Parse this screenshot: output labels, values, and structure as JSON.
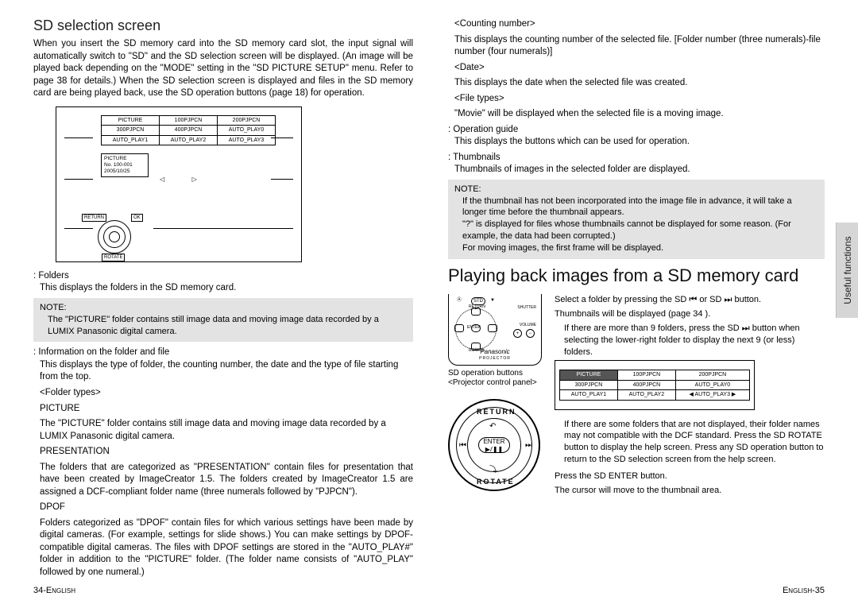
{
  "left": {
    "h2": "SD selection screen",
    "intro": "When you insert the SD memory card into the SD memory card slot, the input signal will automatically switch to \"SD\" and the SD selection screen will be displayed. (An image will be played back depending on the \"MODE\" setting in the \"SD PICTURE SETUP\" menu. Refer to page 38 for details.) When the SD selection screen is displayed and files in the SD memory card are being played back, use the SD operation buttons (page 18) for operation.",
    "diagram": {
      "tbl": [
        [
          "PICTURE",
          "100PJPCN",
          "200PJPCN"
        ],
        [
          "300PJPCN",
          "400PJPCN",
          "AUTO_PLAY0"
        ],
        [
          "AUTO_PLAY1",
          "AUTO_PLAY2",
          "AUTO_PLAY3"
        ]
      ],
      "info": [
        "PICTURE",
        "No. 100-001",
        "2005/10/25"
      ],
      "pad": {
        "return": "RETURN",
        "ok": "OK",
        "rotate": "ROTATE"
      }
    },
    "folders_lbl": ": Folders",
    "folders_txt": "This displays the folders in the SD memory card.",
    "note1_hd": "NOTE:",
    "note1_txt": "The \"PICTURE\" folder contains still image data and moving image data recorded by a LUMIX Panasonic digital camera.",
    "info_lbl": ": Information on the folder and file",
    "info_txt": "This displays the type of folder, the counting number, the date and the type of file starting from the top.",
    "ft_lbl": "<Folder types>",
    "picture_hd": "PICTURE",
    "picture_txt": "The \"PICTURE\" folder contains still image data and moving image data recorded by a LUMIX Panasonic digital camera.",
    "pres_hd": "PRESENTATION",
    "pres_txt": "The folders that are categorized as \"PRESENTATION\" contain files for presentation that have been created by ImageCreator 1.5. The folders created by ImageCreator 1.5 are assigned a DCF-compliant folder name (three numerals followed by \"PJPCN\").",
    "dpof_hd": "DPOF",
    "dpof_txt": "Folders categorized as \"DPOF\" contain files for which various settings have been made by digital cameras. (For example, settings for slide shows.) You can make settings by DPOF-compatible digital cameras. The files with DPOF settings are stored in the \"AUTO_PLAY#\" folder in addition to the \"PICTURE\" folder. (The folder name consists of \"AUTO_PLAY\" followed by one numeral.)",
    "footer": "34-English"
  },
  "right": {
    "cnt_lbl": "<Counting number>",
    "cnt_txt": "This displays the counting number of the selected file. [Folder number (three numerals)-file number (four numerals)]",
    "date_lbl": "<Date>",
    "date_txt": "This displays the date when the selected file was created.",
    "ftypes_lbl": "<File types>",
    "ftypes_txt": "\"Movie\" will be displayed when the selected file is a moving image.",
    "op_lbl": ": Operation guide",
    "op_txt": "This displays the buttons which can be used for operation.",
    "th_lbl": ": Thumbnails",
    "th_txt": "Thumbnails of images in the selected folder are displayed.",
    "note2_hd": "NOTE:",
    "note2_txt": "If the thumbnail has not been incorporated into the image file in advance, it will take a longer time before the thumbnail appears.\n\"?\" is displayed for files whose thumbnails cannot be displayed for some reason. (For example, the data had been corrupted.)\nFor moving images, the first frame will be displayed.",
    "h2": "Playing back images from a SD memory card",
    "side_tab": "Useful functions",
    "remote_caption": "SD operation buttons <Projector control panel>",
    "remote_brand": "Panasonic",
    "remote_sub": "PROJECTOR",
    "big_ctrl": {
      "return": "RETURN",
      "enter": "ENTER",
      "playpause": "▶/❚❚",
      "rotate": "ROTATE"
    },
    "step1a": "Select a folder by pressing the SD ⏮ or SD ⏭ button.",
    "step1b": "Thumbnails will be displayed (page 34    ).",
    "step1c": "If there are more than 9 folders, press the SD ⏭ button when selecting the lower-right folder to display the next 9 (or less) folders.",
    "tbl2": [
      [
        "PICTURE",
        "100PJPCN",
        "200PJPCN"
      ],
      [
        "300PJPCN",
        "400PJPCN",
        "AUTO_PLAY0"
      ],
      [
        "AUTO_PLAY1",
        "AUTO_PLAY2",
        "◀  AUTO_PLAY3  ▶"
      ]
    ],
    "step1d": "If there are some folders that are not displayed, their folder names may not compatible with the DCF standard. Press the SD ROTATE button to display the help screen. Press any SD operation button to return to the SD selection screen from the help screen.",
    "step2a": "Press the SD ENTER button.",
    "step2b": "The cursor will move to the thumbnail area.",
    "footer": "English-35"
  }
}
